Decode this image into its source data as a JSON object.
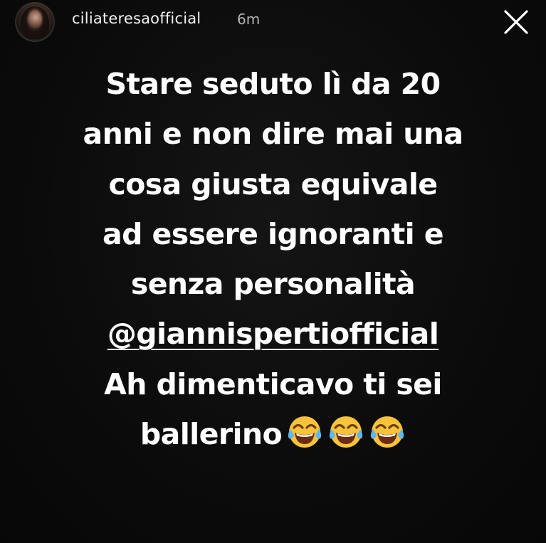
{
  "header": {
    "username": "ciliateresaofficial",
    "timestamp": "6m",
    "avatar_icon": "profile-avatar",
    "close_icon": "close-icon"
  },
  "story": {
    "lines": [
      "Stare seduto lì da 20",
      "anni e non dire mai una",
      "cosa giusta equivale",
      "ad essere ignoranti e",
      "senza personalità"
    ],
    "mention": "@giannispertiofficial",
    "line_after_mention": "Ah dimenticavo ti sei",
    "last_line_text": "ballerino",
    "emoji_icons": [
      "tears-of-joy-emoji",
      "tears-of-joy-emoji",
      "tears-of-joy-emoji"
    ]
  },
  "colors": {
    "background": "#0b0b0b",
    "text": "#ffffff",
    "timestamp": "#b5b5b5",
    "emoji_face": "#f7c33b"
  }
}
